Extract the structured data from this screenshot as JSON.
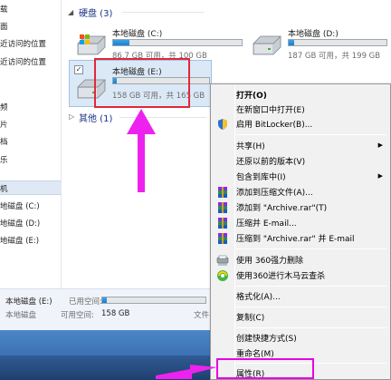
{
  "nav": {
    "items": [
      "载",
      "面",
      "近访问的位置",
      "",
      "",
      "频",
      "片",
      "档",
      "乐",
      "",
      "机",
      "地磁盘 (C:)",
      "地磁盘 (D:)",
      "地磁盘 (E:)"
    ]
  },
  "content": {
    "hard_disks_header": "硬盘 (3)",
    "other_header": "其他 (1)",
    "drives": [
      {
        "name": "本地磁盘 (C:)",
        "info": "86.7 GB 可用，共 100 GB",
        "used_fraction": 0.13
      },
      {
        "name": "本地磁盘 (D:)",
        "info": "187 GB 可用，共 199 GB",
        "used_fraction": 0.06
      },
      {
        "name": "本地磁盘 (E:)",
        "info": "158 GB 可用，共 165 GB",
        "used_fraction": 0.04
      }
    ]
  },
  "details": {
    "name": "本地磁盘 (E:)",
    "used_label": "已用空间:",
    "used_fraction": 0.04,
    "type": "本地磁盘",
    "free_label": "可用空间:",
    "free_value": "158 GB",
    "fs_label": "文件"
  },
  "menu": {
    "items": [
      {
        "label": "打开(O)",
        "bold": true,
        "icon": "",
        "submenu": false
      },
      {
        "label": "在新窗口中打开(E)",
        "icon": "",
        "submenu": false
      },
      {
        "label": "启用 BitLocker(B)...",
        "icon": "shield-icon",
        "submenu": false
      },
      {
        "sep": true
      },
      {
        "label": "共享(H)",
        "icon": "",
        "submenu": true
      },
      {
        "label": "还原以前的版本(V)",
        "icon": "",
        "submenu": false
      },
      {
        "label": "包含到库中(I)",
        "icon": "",
        "submenu": true
      },
      {
        "label": "添加到压缩文件(A)...",
        "icon": "winrar-icon",
        "submenu": false
      },
      {
        "label": "添加到 \"Archive.rar\"(T)",
        "icon": "winrar-icon",
        "submenu": false
      },
      {
        "label": "压缩并 E-mail...",
        "icon": "winrar-icon",
        "submenu": false
      },
      {
        "label": "压缩到 \"Archive.rar\" 并 E-mail",
        "icon": "winrar-icon",
        "submenu": false
      },
      {
        "sep": true
      },
      {
        "label": "使用 360强力删除",
        "icon": "shredder-icon",
        "submenu": false
      },
      {
        "label": "使用360进行木马云查杀",
        "icon": "360-icon",
        "submenu": false
      },
      {
        "sep": true
      },
      {
        "label": "格式化(A)...",
        "icon": "",
        "submenu": false
      },
      {
        "sep": true
      },
      {
        "label": "复制(C)",
        "icon": "",
        "submenu": false
      },
      {
        "sep": true
      },
      {
        "label": "创建快捷方式(S)",
        "icon": "",
        "submenu": false
      },
      {
        "label": "重命名(M)",
        "icon": "",
        "submenu": false
      },
      {
        "sep": true
      },
      {
        "label": "属性(R)",
        "icon": "",
        "submenu": false
      }
    ]
  },
  "colors": {
    "red_highlight": "#e0283a",
    "magenta_highlight": "#e600e6",
    "arrow": "#ee22ee",
    "drive_bar": "#1b7fcd"
  }
}
